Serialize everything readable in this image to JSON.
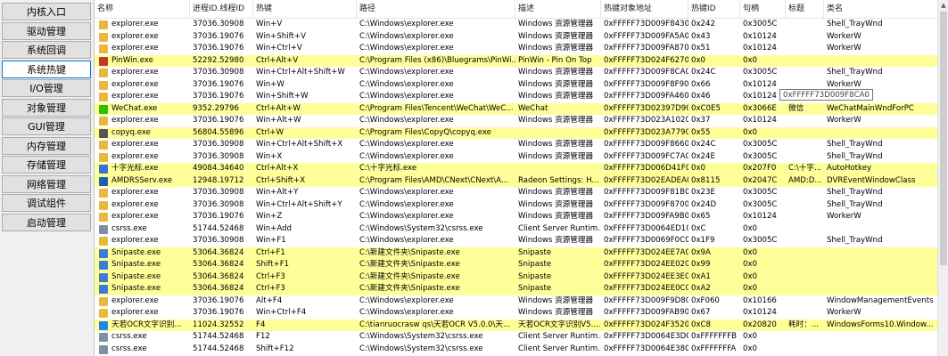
{
  "sidebar": {
    "items": [
      {
        "label": "内核入口",
        "active": false
      },
      {
        "label": "驱动管理",
        "active": false
      },
      {
        "label": "系统回调",
        "active": false
      },
      {
        "label": "系统热键",
        "active": true
      },
      {
        "label": "I/O管理",
        "active": false
      },
      {
        "label": "对象管理",
        "active": false
      },
      {
        "label": "GUI管理",
        "active": false
      },
      {
        "label": "内存管理",
        "active": false
      },
      {
        "label": "存储管理",
        "active": false
      },
      {
        "label": "网络管理",
        "active": false
      },
      {
        "label": "调试组件",
        "active": false
      },
      {
        "label": "启动管理",
        "active": false
      }
    ]
  },
  "table": {
    "headers": [
      "名称",
      "进程ID.线程ID",
      "热键",
      "路径",
      "描述",
      "热键对象地址",
      "热键ID",
      "句柄",
      "标题",
      "类名"
    ],
    "rows": [
      {
        "icon": "explorer-icon",
        "hl": false,
        "cells": [
          "explorer.exe",
          "37036.30908",
          "Win+V",
          "C:\\Windows\\explorer.exe",
          "Windows 资源管理器",
          "0xFFFFF73D009F8430",
          "0x242",
          "0x3005C",
          "",
          "Shell_TrayWnd"
        ]
      },
      {
        "icon": "explorer-icon",
        "hl": false,
        "cells": [
          "explorer.exe",
          "37036.19076",
          "Win+Shift+V",
          "C:\\Windows\\explorer.exe",
          "Windows 资源管理器",
          "0xFFFFF73D009FA5A0",
          "0x43",
          "0x10124",
          "",
          "WorkerW"
        ]
      },
      {
        "icon": "explorer-icon",
        "hl": false,
        "cells": [
          "explorer.exe",
          "37036.19076",
          "Win+Ctrl+V",
          "C:\\Windows\\explorer.exe",
          "Windows 资源管理器",
          "0xFFFFF73D009FA870",
          "0x51",
          "0x10124",
          "",
          "WorkerW"
        ]
      },
      {
        "icon": "pin-icon",
        "hl": true,
        "cells": [
          "PinWin.exe",
          "52292.52980",
          "Ctrl+Alt+V",
          "C:\\Program Files (x86)\\Bluegrams\\PinWi...",
          "PinWin - Pin On Top",
          "0xFFFFF73D024F6270",
          "0x0",
          "0x0",
          "",
          ""
        ]
      },
      {
        "icon": "explorer-icon",
        "hl": false,
        "cells": [
          "explorer.exe",
          "37036.30908",
          "Win+Ctrl+Alt+Shift+W",
          "C:\\Windows\\explorer.exe",
          "Windows 资源管理器",
          "0xFFFFF73D009F8CA0",
          "0x24C",
          "0x3005C",
          "",
          "Shell_TrayWnd"
        ]
      },
      {
        "icon": "explorer-icon",
        "hl": false,
        "cells": [
          "explorer.exe",
          "37036.19076",
          "Win+W",
          "C:\\Windows\\explorer.exe",
          "Windows 资源管理器",
          "0xFFFFF73D009F8F90",
          "0x66",
          "0x10124",
          "",
          "WorkerW"
        ]
      },
      {
        "icon": "explorer-icon",
        "hl": false,
        "cells": [
          "explorer.exe",
          "37036.19076",
          "Win+Shift+W",
          "C:\\Windows\\explorer.exe",
          "Windows 资源管理器",
          "0xFFFFF73D009FA460",
          "0x46",
          "0x10124",
          "",
          "WorkerW"
        ]
      },
      {
        "icon": "wechat-icon",
        "hl": true,
        "cells": [
          "WeChat.exe",
          "9352.29796",
          "Ctrl+Alt+W",
          "C:\\Program Files\\Tencent\\WeChat\\WeC...",
          "WeChat",
          "0xFFFFF73D02397D90",
          "0xC0E5",
          "0x3066E",
          "微信",
          "WeChatMainWndForPC"
        ]
      },
      {
        "icon": "explorer-icon",
        "hl": false,
        "cells": [
          "explorer.exe",
          "37036.19076",
          "Win+Alt+W",
          "C:\\Windows\\explorer.exe",
          "Windows 资源管理器",
          "0xFFFFF73D023A1020",
          "0x37",
          "0x10124",
          "",
          "WorkerW"
        ]
      },
      {
        "icon": "copyq-icon",
        "hl": true,
        "cells": [
          "copyq.exe",
          "56804.55896",
          "Ctrl+W",
          "C:\\Program Files\\CopyQ\\copyq.exe",
          "",
          "0xFFFFF73D023A7790",
          "0x55",
          "0x0",
          "",
          ""
        ]
      },
      {
        "icon": "explorer-icon",
        "hl": false,
        "cells": [
          "explorer.exe",
          "37036.30908",
          "Win+Ctrl+Alt+Shift+X",
          "C:\\Windows\\explorer.exe",
          "Windows 资源管理器",
          "0xFFFFF73D009F8660",
          "0x24C",
          "0x3005C",
          "",
          "Shell_TrayWnd"
        ]
      },
      {
        "icon": "explorer-icon",
        "hl": false,
        "cells": [
          "explorer.exe",
          "37036.30908",
          "Win+X",
          "C:\\Windows\\explorer.exe",
          "Windows 资源管理器",
          "0xFFFFF73D009FC7A0",
          "0x24E",
          "0x3005C",
          "",
          "Shell_TrayWnd"
        ]
      },
      {
        "icon": "crosshair-icon",
        "hl": true,
        "cells": [
          "十字光标.exe",
          "49084.34640",
          "Ctrl+Alt+X",
          "C:\\十字光标.exe",
          "",
          "0xFFFFF73D006D41F0",
          "0x0",
          "0x207F0",
          "C:\\十字...",
          "AutoHotkey"
        ]
      },
      {
        "icon": "amd-icon",
        "hl": true,
        "cells": [
          "AMDRSServ.exe",
          "12948.19712",
          "Ctrl+Shift+X",
          "C:\\Program Files\\AMD\\CNext\\CNext\\A...",
          "Radeon Settings: H...",
          "0xFFFFF73D02EADEA0",
          "0x8115",
          "0x2047C",
          "AMD:D...",
          "DVREventWindowClass"
        ]
      },
      {
        "icon": "explorer-icon",
        "hl": false,
        "cells": [
          "explorer.exe",
          "37036.30908",
          "Win+Alt+Y",
          "C:\\Windows\\explorer.exe",
          "Windows 资源管理器",
          "0xFFFFF73D009F81B0",
          "0x23E",
          "0x3005C",
          "",
          "Shell_TrayWnd"
        ]
      },
      {
        "icon": "explorer-icon",
        "hl": false,
        "cells": [
          "explorer.exe",
          "37036.30908",
          "Win+Ctrl+Alt+Shift+Y",
          "C:\\Windows\\explorer.exe",
          "Windows 资源管理器",
          "0xFFFFF73D009F8700",
          "0x24D",
          "0x3005C",
          "",
          "Shell_TrayWnd"
        ]
      },
      {
        "icon": "explorer-icon",
        "hl": false,
        "cells": [
          "explorer.exe",
          "37036.19076",
          "Win+Z",
          "C:\\Windows\\explorer.exe",
          "Windows 资源管理器",
          "0xFFFFF73D009FA9B0",
          "0x65",
          "0x10124",
          "",
          "WorkerW"
        ]
      },
      {
        "icon": "csrss-icon",
        "hl": false,
        "cells": [
          "csrss.exe",
          "51744.52468",
          "Win+Add",
          "C:\\Windows\\System32\\csrss.exe",
          "Client Server Runtim...",
          "0xFFFFF73D0064ED10",
          "0xC",
          "0x0",
          "",
          ""
        ]
      },
      {
        "icon": "explorer-icon",
        "hl": false,
        "cells": [
          "explorer.exe",
          "37036.30908",
          "Win+F1",
          "C:\\Windows\\explorer.exe",
          "Windows 资源管理器",
          "0xFFFFF73D0069F0C0",
          "0x1F9",
          "0x3005C",
          "",
          "Shell_TrayWnd"
        ]
      },
      {
        "icon": "snipaste-icon",
        "hl": true,
        "cells": [
          "Snipaste.exe",
          "53064.36824",
          "Ctrl+F1",
          "C:\\新建文件夹\\Snipaste.exe",
          "Snipaste",
          "0xFFFFF73D024EE7A0",
          "0x9A",
          "0x0",
          "",
          ""
        ]
      },
      {
        "icon": "snipaste-icon",
        "hl": true,
        "cells": [
          "Snipaste.exe",
          "53064.36824",
          "Shift+F1",
          "C:\\新建文件夹\\Snipaste.exe",
          "Snipaste",
          "0xFFFFF73D024EE020",
          "0x99",
          "0x0",
          "",
          ""
        ]
      },
      {
        "icon": "snipaste-icon",
        "hl": true,
        "cells": [
          "Snipaste.exe",
          "53064.36824",
          "Ctrl+F3",
          "C:\\新建文件夹\\Snipaste.exe",
          "Snipaste",
          "0xFFFFF73D024EE3E0",
          "0xA1",
          "0x0",
          "",
          ""
        ]
      },
      {
        "icon": "snipaste-icon",
        "hl": true,
        "cells": [
          "Snipaste.exe",
          "53064.36824",
          "Ctrl+F3",
          "C:\\新建文件夹\\Snipaste.exe",
          "Snipaste",
          "0xFFFFF73D024EE0C0",
          "0xA2",
          "0x0",
          "",
          ""
        ]
      },
      {
        "icon": "explorer-icon",
        "hl": false,
        "cells": [
          "explorer.exe",
          "37036.19076",
          "Alt+F4",
          "C:\\Windows\\explorer.exe",
          "Windows 资源管理器",
          "0xFFFFF73D009F9D80",
          "0xF060",
          "0x10166",
          "",
          "WindowManagementEvents"
        ]
      },
      {
        "icon": "explorer-icon",
        "hl": false,
        "cells": [
          "explorer.exe",
          "37036.19076",
          "Win+Ctrl+F4",
          "C:\\Windows\\explorer.exe",
          "Windows 资源管理器",
          "0xFFFFF73D009FAB90",
          "0x67",
          "0x10124",
          "",
          "WorkerW"
        ]
      },
      {
        "icon": "ocr-icon",
        "hl": true,
        "cells": [
          "天若OCR文字识别...",
          "11024.32552",
          "F4",
          "C:\\tianruocrasw qs\\天若OCR V5.0.0\\天...",
          "天若OCR文字识别V5....",
          "0xFFFFF73D024F3520",
          "0xC8",
          "0x20820",
          "耗时：...",
          "WindowsForms10.Window..."
        ]
      },
      {
        "icon": "csrss-icon",
        "hl": false,
        "cells": [
          "csrss.exe",
          "51744.52468",
          "F12",
          "C:\\Windows\\System32\\csrss.exe",
          "Client Server Runtim...",
          "0xFFFFF73D0064E3D0",
          "0xFFFFFFFB",
          "0x0",
          "",
          ""
        ]
      },
      {
        "icon": "csrss-icon",
        "hl": false,
        "cells": [
          "csrss.exe",
          "51744.52468",
          "Shift+F12",
          "C:\\Windows\\System32\\csrss.exe",
          "Client Server Runtim...",
          "0xFFFFF73D0064E380",
          "0xFFFFFFFA",
          "0x0",
          "",
          ""
        ]
      }
    ]
  },
  "tooltip": {
    "text": "0xFFFFF73D009F8CA0"
  },
  "icon_colors": {
    "explorer-icon": "#e8b93c",
    "pin-icon": "#c0392b",
    "wechat-icon": "#2dc100",
    "copyq-icon": "#555555",
    "crosshair-icon": "#3a6fd8",
    "amd-icon": "#2060b0",
    "csrss-icon": "#7f8fa6",
    "snipaste-icon": "#3b7bd4",
    "ocr-icon": "#1e88e5"
  },
  "colors": {
    "highlight_row": "#ffff99",
    "active_sidebar_border": "#0078d7"
  }
}
